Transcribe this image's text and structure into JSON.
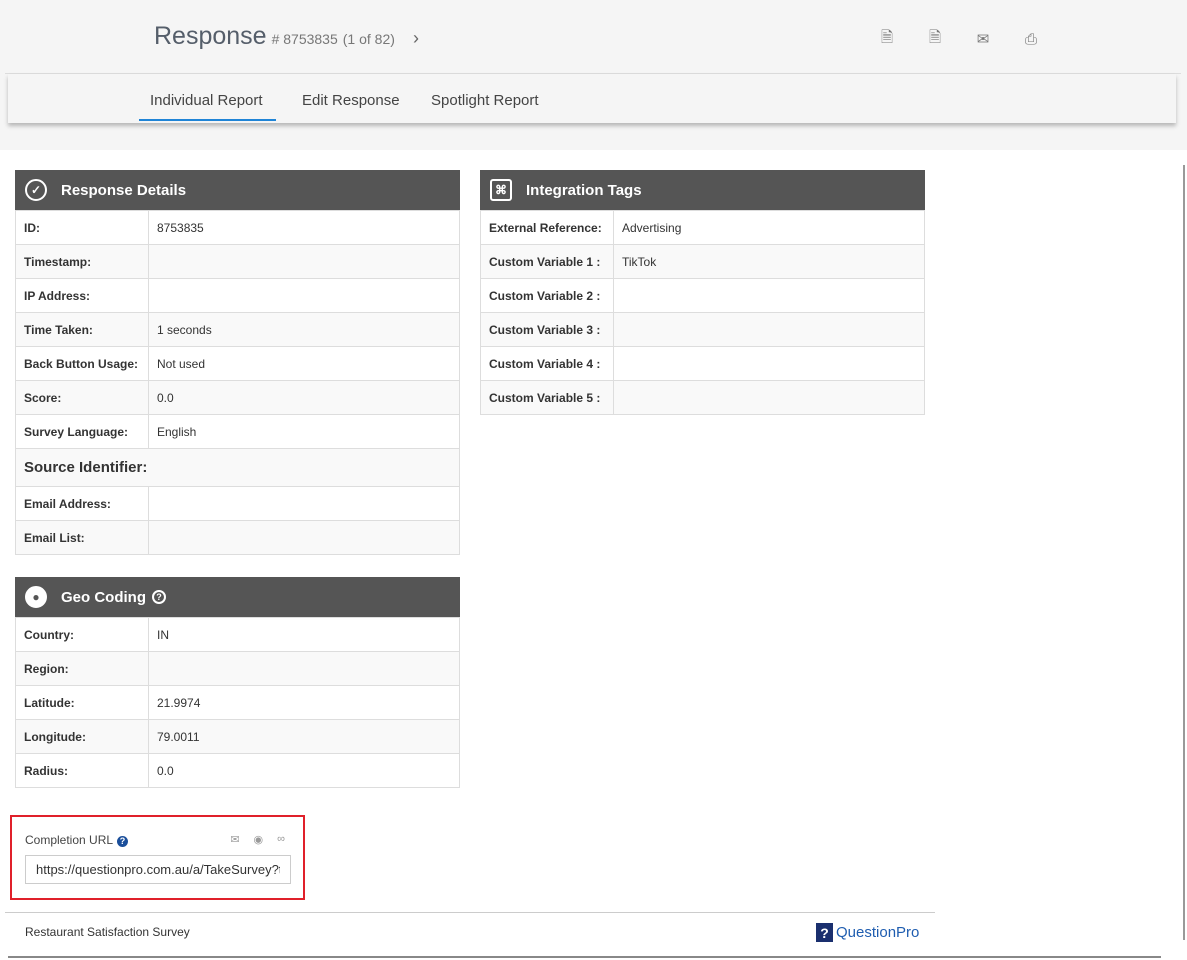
{
  "header": {
    "title": "Response",
    "id": "# 8753835",
    "position": "(1 of 82)"
  },
  "tabs": [
    "Individual Report",
    "Edit Response",
    "Spotlight Report"
  ],
  "response_details": {
    "title": "Response Details",
    "rows": [
      [
        "ID:",
        "8753835"
      ],
      [
        "Timestamp:",
        ""
      ],
      [
        "IP Address:",
        ""
      ],
      [
        "Time Taken:",
        "1 seconds"
      ],
      [
        "Back Button Usage:",
        "Not used"
      ],
      [
        "Score:",
        "0.0"
      ],
      [
        "Survey Language:",
        "English"
      ]
    ],
    "source_heading": "Source Identifier:",
    "source_rows": [
      [
        "Email Address:",
        ""
      ],
      [
        "Email List:",
        ""
      ]
    ]
  },
  "integration": {
    "title": "Integration Tags",
    "rows": [
      [
        "External Reference:",
        "Advertising"
      ],
      [
        "Custom Variable 1 :",
        "TikTok"
      ],
      [
        "Custom Variable 2 :",
        ""
      ],
      [
        "Custom Variable 3 :",
        ""
      ],
      [
        "Custom Variable 4 :",
        ""
      ],
      [
        "Custom Variable 5 :",
        ""
      ]
    ]
  },
  "geo": {
    "title": "Geo Coding",
    "rows": [
      [
        "Country:",
        "IN"
      ],
      [
        "Region:",
        ""
      ],
      [
        "Latitude:",
        "21.9974"
      ],
      [
        "Longitude:",
        "79.0011"
      ],
      [
        "Radius:",
        "0.0"
      ]
    ]
  },
  "completion": {
    "label": "Completion URL",
    "url": "https://questionpro.com.au/a/TakeSurvey?tt"
  },
  "footer": {
    "survey": "Restaurant Satisfaction Survey",
    "brand": "QuestionPro"
  }
}
